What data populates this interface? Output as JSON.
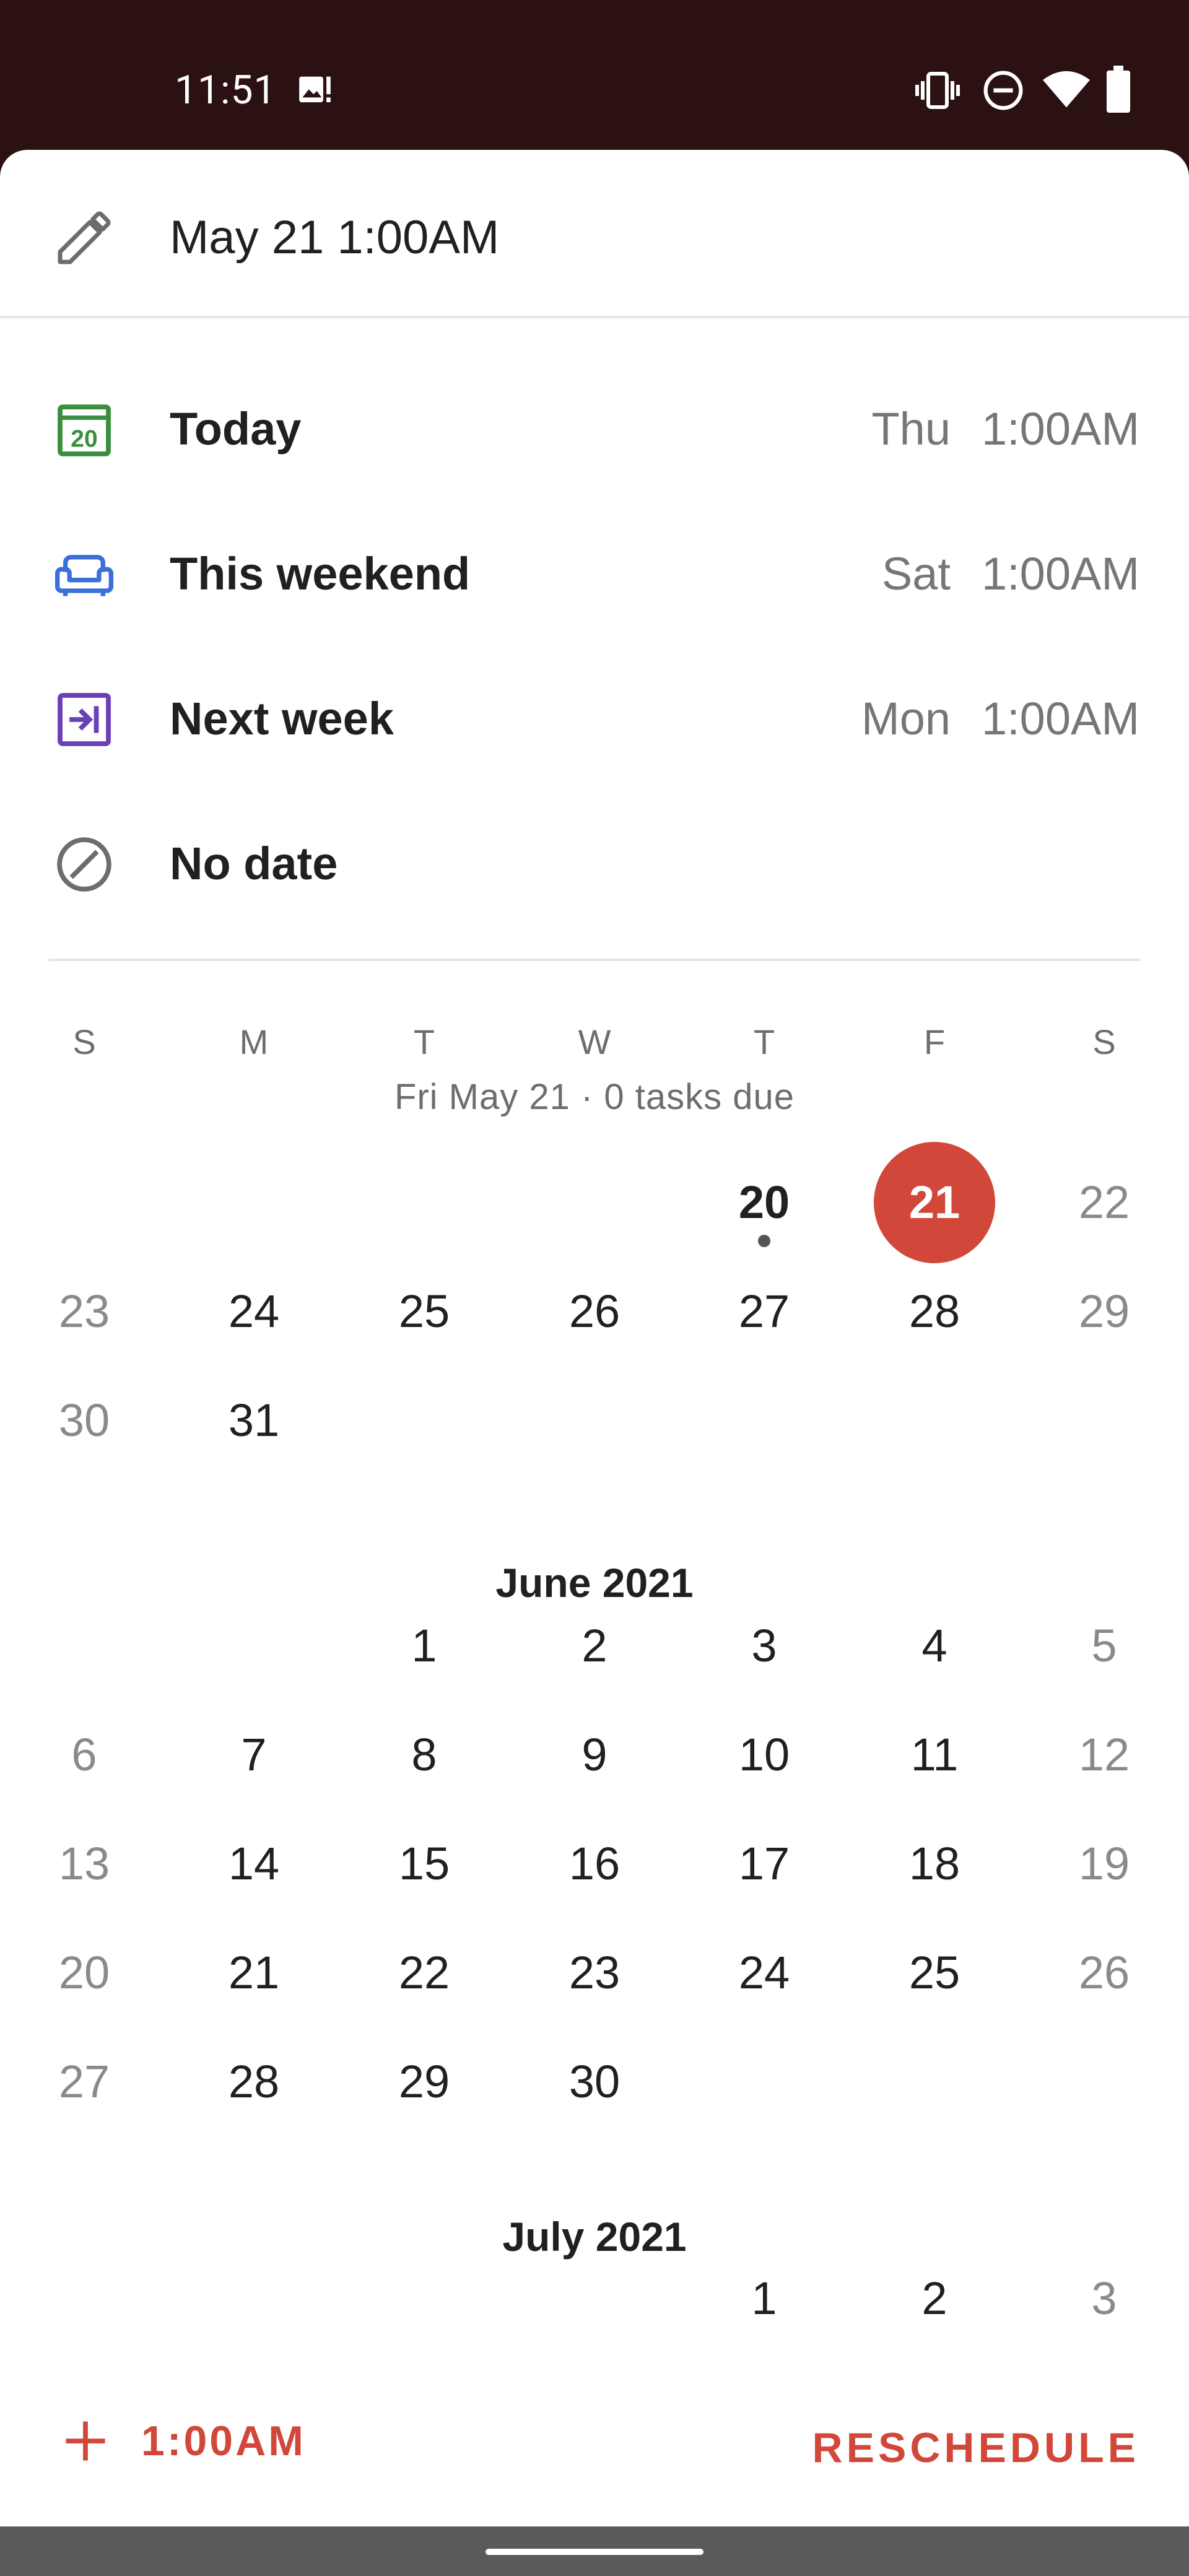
{
  "status_bar": {
    "time": "11:51"
  },
  "header": {
    "title": "May 21 1:00AM"
  },
  "options": [
    {
      "label": "Today",
      "day": "Thu",
      "time": "1:00AM",
      "icon": "calendar-today-icon",
      "color": "#3a8f3e"
    },
    {
      "label": "This weekend",
      "day": "Sat",
      "time": "1:00AM",
      "icon": "couch-icon",
      "color": "#3b6fd9"
    },
    {
      "label": "Next week",
      "day": "Mon",
      "time": "1:00AM",
      "icon": "arrow-into-box-icon",
      "color": "#6a3fb8"
    },
    {
      "label": "No date",
      "icon": "no-date-icon",
      "color": "#6d6d6d"
    }
  ],
  "calendar": {
    "weekdays": [
      "S",
      "M",
      "T",
      "W",
      "T",
      "F",
      "S"
    ],
    "summary": "Fri May 21 · 0 tasks due",
    "today_icon_number": "20",
    "may_rows": [
      [
        "",
        "",
        "",
        "",
        "20",
        "21",
        "22"
      ],
      [
        "23",
        "24",
        "25",
        "26",
        "27",
        "28",
        "29"
      ],
      [
        "30",
        "31",
        "",
        "",
        "",
        "",
        ""
      ]
    ],
    "june_title": "June 2021",
    "june_rows": [
      [
        "",
        "",
        "1",
        "2",
        "3",
        "4",
        "5"
      ],
      [
        "6",
        "7",
        "8",
        "9",
        "10",
        "11",
        "12"
      ],
      [
        "13",
        "14",
        "15",
        "16",
        "17",
        "18",
        "19"
      ],
      [
        "20",
        "21",
        "22",
        "23",
        "24",
        "25",
        "26"
      ],
      [
        "27",
        "28",
        "29",
        "30",
        "",
        "",
        ""
      ]
    ],
    "july_title": "July 2021",
    "july_rows": [
      [
        "",
        "",
        "",
        "",
        "1",
        "2",
        "3"
      ]
    ],
    "today": "20",
    "selected": "21",
    "accent_color": "#d1483a"
  },
  "footer": {
    "time_label": "1:00AM",
    "reschedule_label": "RESCHEDULE"
  }
}
